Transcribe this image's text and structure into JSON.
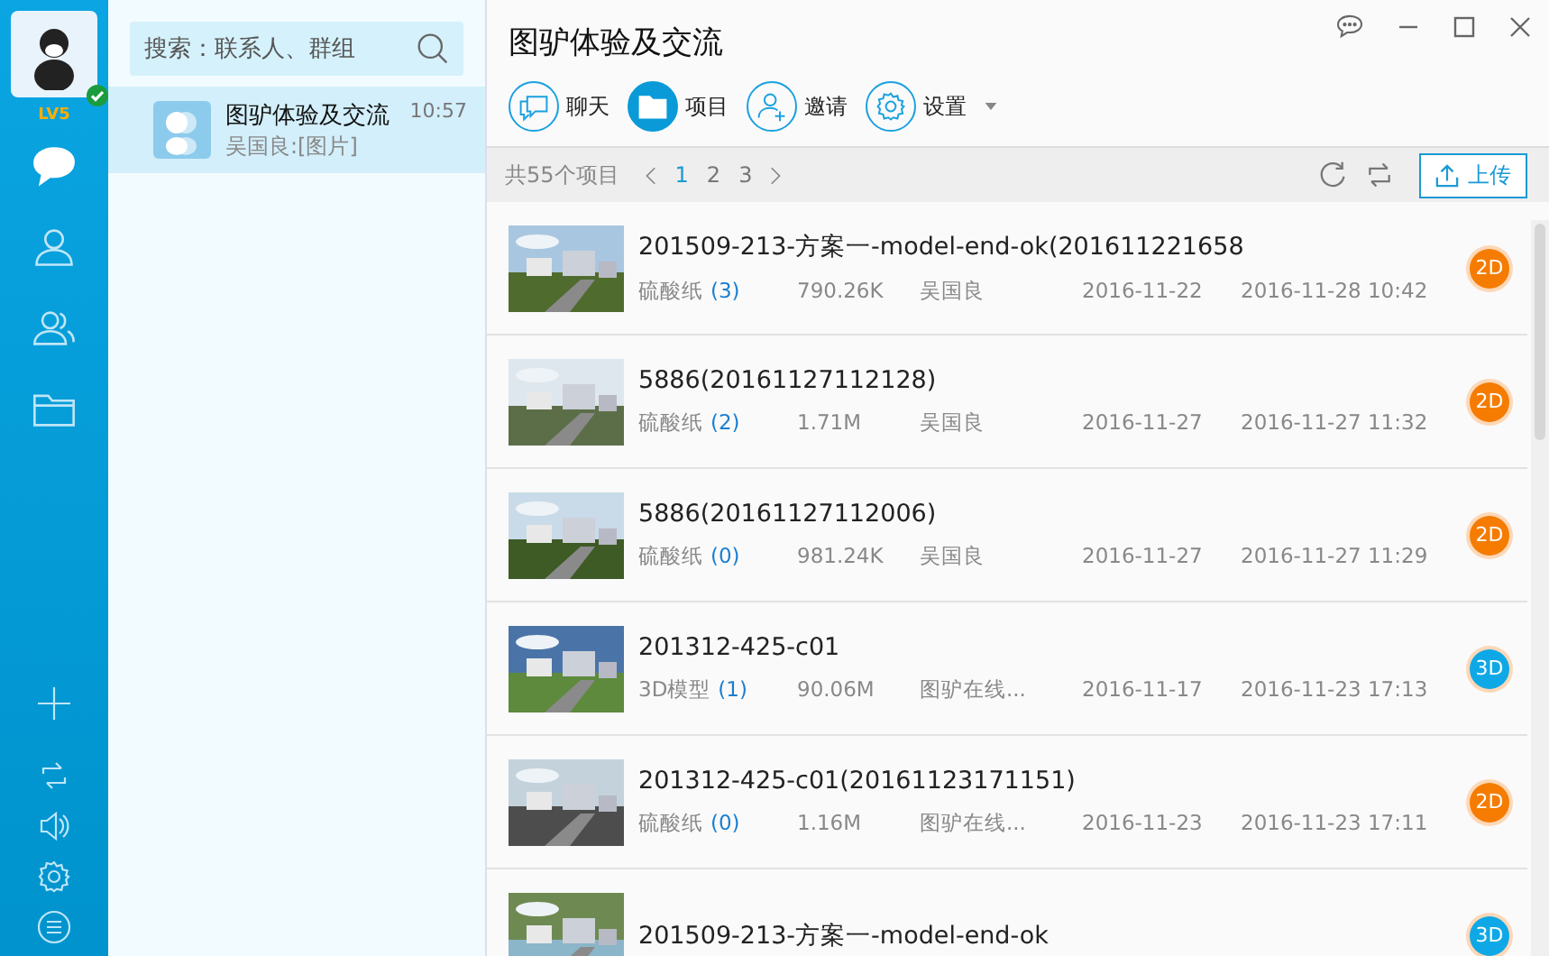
{
  "user": {
    "level": "LV5",
    "online": true
  },
  "nav": [
    {
      "kind": "chat",
      "selected": true
    },
    {
      "kind": "contact",
      "selected": false
    },
    {
      "kind": "group",
      "selected": false
    },
    {
      "kind": "folder",
      "selected": false
    }
  ],
  "nav_bottom": [
    {
      "kind": "add"
    },
    {
      "kind": "sync"
    },
    {
      "kind": "sound"
    },
    {
      "kind": "settings"
    },
    {
      "kind": "menu"
    }
  ],
  "search": {
    "placeholder": "搜索：联系人、群组"
  },
  "conversations": [
    {
      "name": "图驴体验及交流",
      "time": "10:57",
      "preview": "吴国良:[图片]",
      "selected": true
    }
  ],
  "title": "图驴体验及交流",
  "toolbar": [
    {
      "kind": "chat",
      "label": "聊天",
      "selected": false
    },
    {
      "kind": "folder",
      "label": "项目",
      "selected": true
    },
    {
      "kind": "invite",
      "label": "邀请",
      "selected": false
    },
    {
      "kind": "settings",
      "label": "设置",
      "selected": false,
      "dropdown": true
    }
  ],
  "summary": "共55个项目",
  "pages": [
    {
      "label": "1",
      "selected": true
    },
    {
      "label": "2",
      "selected": false
    },
    {
      "label": "3",
      "selected": false
    }
  ],
  "upload_label": "上传",
  "projects": [
    {
      "title": "201509-213-方案一-model-end-ok(201611221658",
      "type": "硫酸纸",
      "count": "(3)",
      "size": "790.26K",
      "owner": "吴国良",
      "created": "2016-11-22",
      "modified": "2016-11-28 10:42",
      "badge": "2D",
      "color": "#f57c00"
    },
    {
      "title": "5886(20161127112128)",
      "type": "硫酸纸",
      "count": "(2)",
      "size": "1.71M",
      "owner": "吴国良",
      "created": "2016-11-27",
      "modified": "2016-11-27 11:32",
      "badge": "2D",
      "color": "#f57c00"
    },
    {
      "title": "5886(20161127112006)",
      "type": "硫酸纸",
      "count": "(0)",
      "size": "981.24K",
      "owner": "吴国良",
      "created": "2016-11-27",
      "modified": "2016-11-27 11:29",
      "badge": "2D",
      "color": "#f57c00"
    },
    {
      "title": "201312-425-c01",
      "type": "3D模型",
      "count": "(1)",
      "size": "90.06M",
      "owner": "图驴在线...",
      "created": "2016-11-17",
      "modified": "2016-11-23 17:13",
      "badge": "3D",
      "color": "#0fa8e6"
    },
    {
      "title": "201312-425-c01(20161123171151)",
      "type": "硫酸纸",
      "count": "(0)",
      "size": "1.16M",
      "owner": "图驴在线...",
      "created": "2016-11-23",
      "modified": "2016-11-23 17:11",
      "badge": "2D",
      "color": "#f57c00"
    },
    {
      "title": "201509-213-方案一-model-end-ok",
      "badge": "3D",
      "color": "#0fa8e6"
    }
  ]
}
